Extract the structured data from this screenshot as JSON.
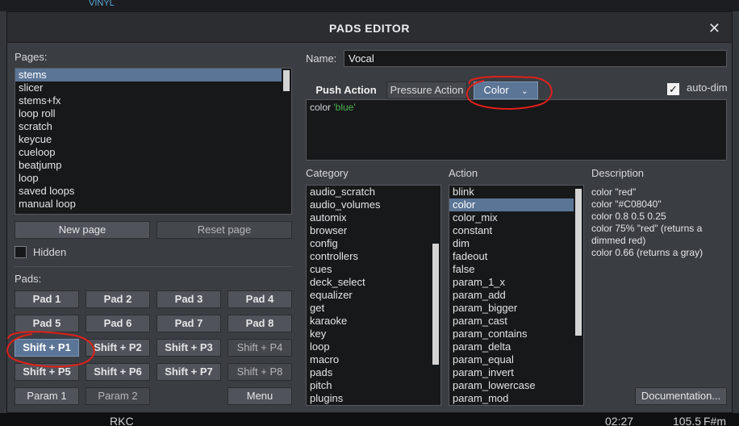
{
  "background": {
    "top_label": "VINYL",
    "bottom_left": "RKC",
    "bottom_time": "02:27",
    "bottom_bpm": "105.5",
    "bottom_key": "F#m"
  },
  "dialog": {
    "title": "PADS EDITOR",
    "close_icon": "close-icon"
  },
  "pages": {
    "label": "Pages:",
    "items": [
      "stems",
      "slicer",
      "stems+fx",
      "loop roll",
      "scratch",
      "keycue",
      "cueloop",
      "beatjump",
      "loop",
      "saved loops",
      "manual loop",
      "..."
    ],
    "selected": "stems",
    "new_page": "New page",
    "reset_page": "Reset page",
    "hidden_label": "Hidden"
  },
  "pads": {
    "label": "Pads:",
    "buttons": [
      [
        "Pad 1",
        "Pad 2",
        "Pad 3",
        "Pad 4"
      ],
      [
        "Pad 5",
        "Pad 6",
        "Pad 7",
        "Pad 8"
      ],
      [
        "Shift + P1",
        "Shift + P2",
        "Shift + P3",
        "Shift + P4"
      ],
      [
        "Shift + P5",
        "Shift + P6",
        "Shift + P7",
        "Shift + P8"
      ]
    ],
    "param1": "Param 1",
    "param2": "Param 2",
    "menu": "Menu"
  },
  "editor": {
    "name_label": "Name:",
    "name_value": "Vocal",
    "tabs": [
      "Push Action",
      "Pressure Action",
      "Color"
    ],
    "active_tab": "Color",
    "chevron_icon": "chevron-down-icon",
    "autodim_label": "auto-dim",
    "autodim_checked": true,
    "code_keyword": "color",
    "code_string": "'blue'"
  },
  "category": {
    "label": "Category",
    "items": [
      "audio_scratch",
      "audio_volumes",
      "automix",
      "browser",
      "config",
      "controllers",
      "cues",
      "deck_select",
      "equalizer",
      "get",
      "karaoke",
      "key",
      "loop",
      "macro",
      "pads",
      "pitch",
      "plugins"
    ]
  },
  "action": {
    "label": "Action",
    "items": [
      "blink",
      "color",
      "color_mix",
      "constant",
      "dim",
      "fadeout",
      "false",
      "param_1_x",
      "param_add",
      "param_bigger",
      "param_cast",
      "param_contains",
      "param_delta",
      "param_equal",
      "param_invert",
      "param_lowercase",
      "param_mod"
    ],
    "selected": "color"
  },
  "description": {
    "label": "Description",
    "lines": [
      "color \"red\"",
      "color \"#C08040\"",
      "color 0.8 0.5 0.25",
      "color 75% \"red\" (returns a dimmed red)",
      "color 0.66 (returns a gray)"
    ],
    "documentation": "Documentation..."
  },
  "colors": {
    "selection": "#5b7596",
    "annotation": "#e0201a",
    "code_string": "#4caf50"
  }
}
